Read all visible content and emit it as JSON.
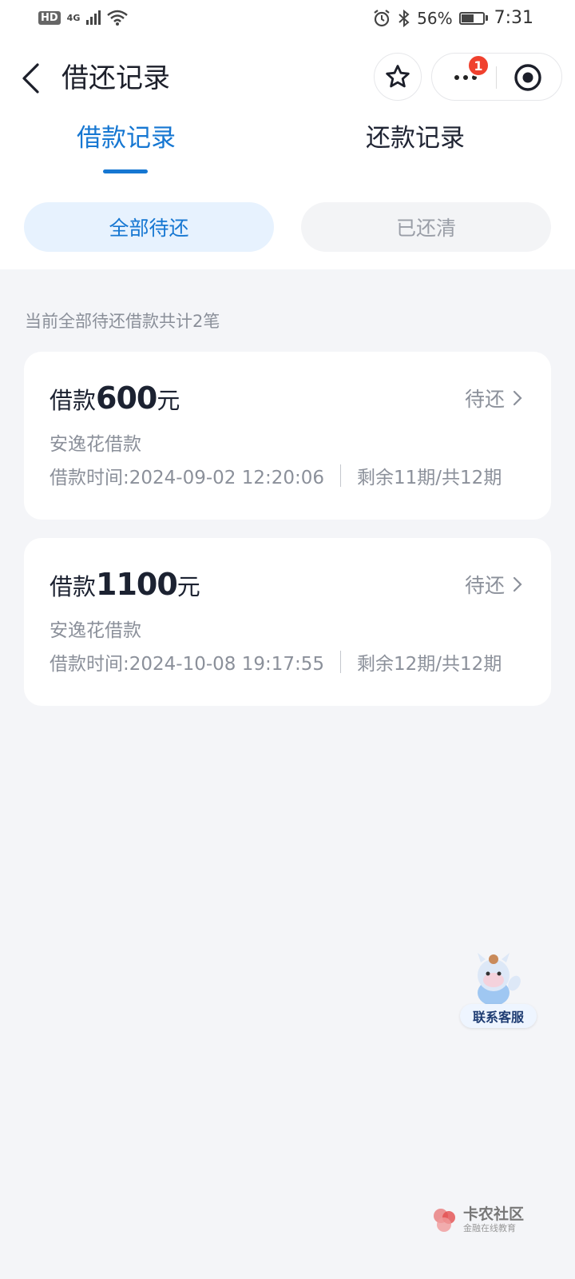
{
  "status_bar": {
    "hd": "HD",
    "network": "4G",
    "battery_pct": "56%",
    "time": "7:31"
  },
  "nav": {
    "title": "借还记录",
    "badge_count": "1"
  },
  "tabs": [
    {
      "label": "借款记录",
      "active": true
    },
    {
      "label": "还款记录",
      "active": false
    }
  ],
  "filters": [
    {
      "label": "全部待还",
      "active": true
    },
    {
      "label": "已还清",
      "active": false
    }
  ],
  "summary": "当前全部待还借款共计2笔",
  "loans": [
    {
      "prefix": "借款",
      "amount": "600",
      "unit": "元",
      "status": "待还",
      "product": "安逸花借款",
      "time": "借款时间:2024-09-02 12:20:06",
      "periods": "剩余11期/共12期"
    },
    {
      "prefix": "借款",
      "amount": "1100",
      "unit": "元",
      "status": "待还",
      "product": "安逸花借款",
      "time": "借款时间:2024-10-08 19:17:55",
      "periods": "剩余12期/共12期"
    }
  ],
  "customer_service": "联系客服",
  "watermark": {
    "title": "卡农社区",
    "subtitle": "金融在线教育"
  },
  "colors": {
    "accent": "#1677d2",
    "badge": "#f0412e",
    "background": "#f4f5f8"
  },
  "icons": [
    "back-arrow-icon",
    "star-icon",
    "more-dots-icon",
    "target-icon",
    "chevron-right-icon",
    "alarm-icon",
    "bluetooth-icon",
    "wifi-icon",
    "signal-icon",
    "battery-icon"
  ]
}
